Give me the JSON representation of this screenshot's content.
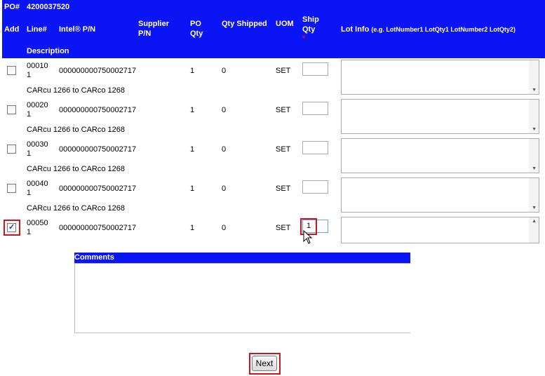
{
  "header": {
    "po_label": "PO#",
    "po_number": "4200037520",
    "columns": {
      "add": "Add",
      "line": "Line#",
      "intel_pn": "Intel® P/N",
      "supplier_pn_1": "Supplier",
      "supplier_pn_2": "P/N",
      "po_qty_1": "PO",
      "po_qty_2": "Qty",
      "qty_shipped": "Qty Shipped",
      "uom": "UOM",
      "ship_qty_1": "Ship",
      "ship_qty_2": "Qty",
      "required_mark": "*",
      "lot_info": "Lot Info",
      "lot_info_hint": "(e.g. LotNumber1 LotQty1 LotNumber2 LotQty2)",
      "description": "Description"
    }
  },
  "rows": [
    {
      "line": "00010",
      "sub": "1",
      "intel_pn": "000000000750002717",
      "po_qty": "1",
      "qty_shipped": "0",
      "uom": "SET",
      "ship_qty": "",
      "checked": false,
      "description": "CARcu 1266 to CARco 1268"
    },
    {
      "line": "00020",
      "sub": "1",
      "intel_pn": "000000000750002717",
      "po_qty": "1",
      "qty_shipped": "0",
      "uom": "SET",
      "ship_qty": "",
      "checked": false,
      "description": "CARcu 1266 to CARco 1268"
    },
    {
      "line": "00030",
      "sub": "1",
      "intel_pn": "000000000750002717",
      "po_qty": "1",
      "qty_shipped": "0",
      "uom": "SET",
      "ship_qty": "",
      "checked": false,
      "description": "CARcu 1266 to CARco 1268"
    },
    {
      "line": "00040",
      "sub": "1",
      "intel_pn": "000000000750002717",
      "po_qty": "1",
      "qty_shipped": "0",
      "uom": "SET",
      "ship_qty": "",
      "checked": false,
      "description": "CARcu 1266 to CARco 1268"
    },
    {
      "line": "00050",
      "sub": "1",
      "intel_pn": "000000000750002717",
      "po_qty": "1",
      "qty_shipped": "0",
      "uom": "SET",
      "ship_qty": "1",
      "checked": true,
      "description": ""
    }
  ],
  "comments": {
    "label": "Comments",
    "value": ""
  },
  "next_button": {
    "label": "Next"
  },
  "colors": {
    "header_bg": "#0a14f5",
    "highlight": "#d0141e",
    "required": "#d0141e"
  }
}
